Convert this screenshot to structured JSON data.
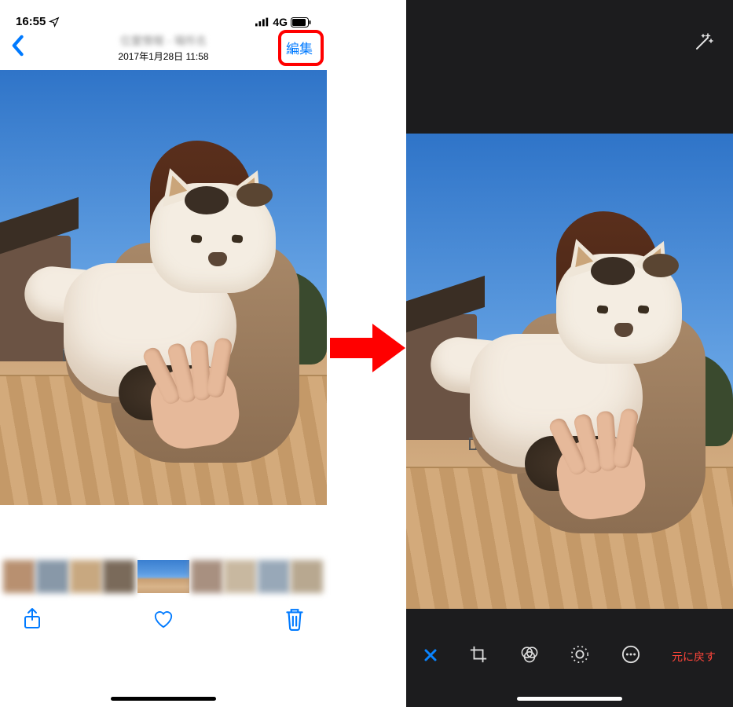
{
  "statusBar": {
    "time": "16:55",
    "network": "4G"
  },
  "viewer": {
    "timestamp": "2017年1月28日 11:58",
    "editLabel": "編集"
  },
  "editor": {
    "revertLabel": "元に戻す"
  }
}
